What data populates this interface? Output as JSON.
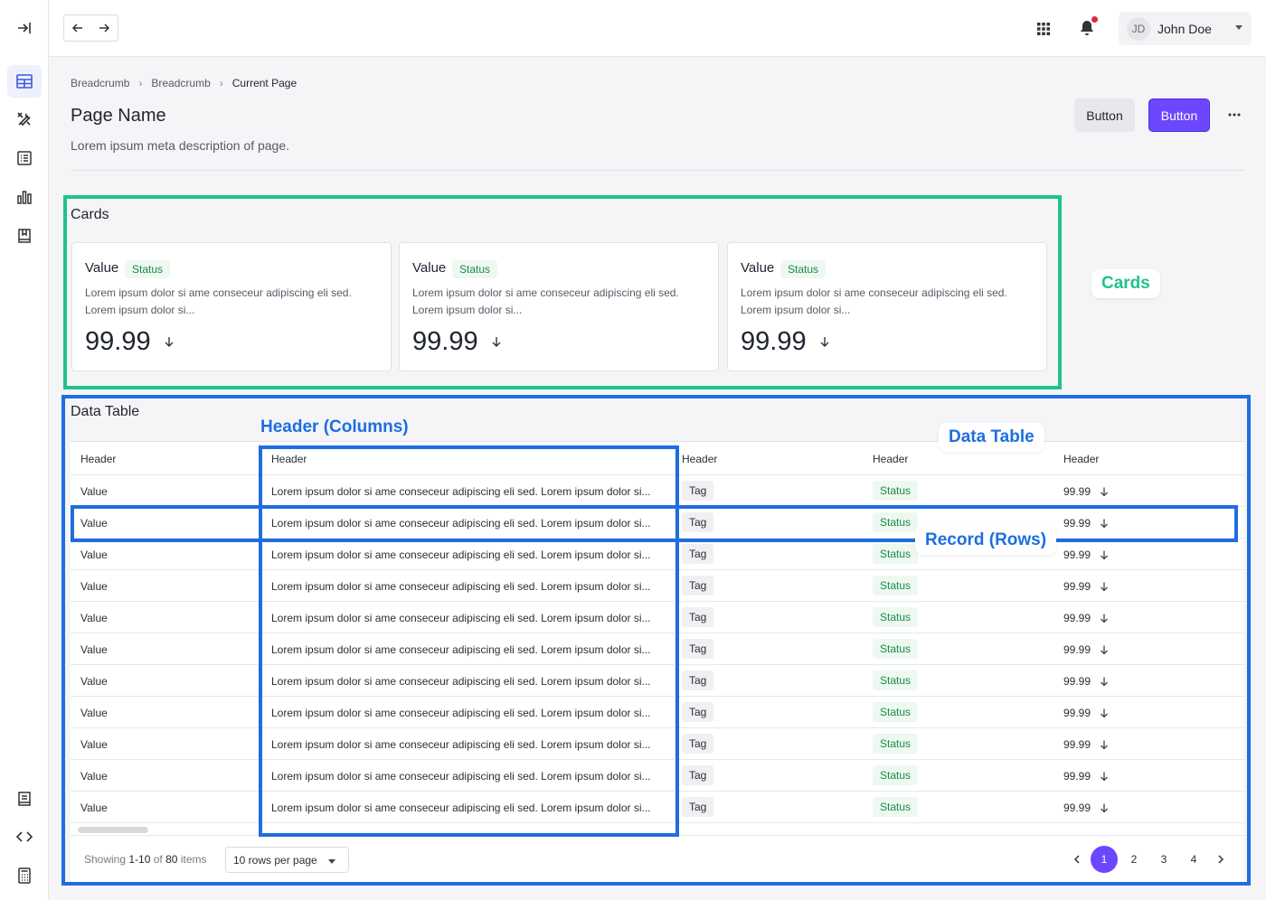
{
  "topbar": {
    "user_initials": "JD",
    "user_name": "John Doe"
  },
  "breadcrumb": [
    "Breadcrumb",
    "Breadcrumb",
    "Current Page"
  ],
  "page": {
    "title": "Page Name",
    "description": "Lorem ipsum meta description of page.",
    "secondary_button": "Button",
    "primary_button": "Button"
  },
  "colors": {
    "primary": "#6c47ff",
    "cards_highlight": "#20c38b",
    "table_highlight": "#1e6ee0",
    "status_text": "#1a8a4a"
  },
  "cards_section": {
    "title": "Cards",
    "cards": [
      {
        "label": "Value",
        "status": "Status",
        "description": "Lorem ipsum dolor si ame conseceur adipiscing eli sed. Lorem ipsum dolor si...",
        "value": "99.99"
      },
      {
        "label": "Value",
        "status": "Status",
        "description": "Lorem ipsum dolor si ame conseceur adipiscing eli sed. Lorem ipsum dolor si...",
        "value": "99.99"
      },
      {
        "label": "Value",
        "status": "Status",
        "description": "Lorem ipsum dolor si ame conseceur adipiscing eli sed. Lorem ipsum dolor si...",
        "value": "99.99"
      }
    ]
  },
  "table_section": {
    "title": "Data Table",
    "headers": [
      "Header",
      "Header",
      "Header",
      "Header",
      "Header"
    ],
    "rows": [
      {
        "value": "Value",
        "text": "Lorem ipsum dolor si ame conseceur adipiscing eli sed. Lorem ipsum dolor si...",
        "tag": "Tag",
        "status": "Status",
        "number": "99.99"
      },
      {
        "value": "Value",
        "text": "Lorem ipsum dolor si ame conseceur adipiscing eli sed. Lorem ipsum dolor si...",
        "tag": "Tag",
        "status": "Status",
        "number": "99.99"
      },
      {
        "value": "Value",
        "text": "Lorem ipsum dolor si ame conseceur adipiscing eli sed. Lorem ipsum dolor si...",
        "tag": "Tag",
        "status": "Status",
        "number": "99.99"
      },
      {
        "value": "Value",
        "text": "Lorem ipsum dolor si ame conseceur adipiscing eli sed. Lorem ipsum dolor si...",
        "tag": "Tag",
        "status": "Status",
        "number": "99.99"
      },
      {
        "value": "Value",
        "text": "Lorem ipsum dolor si ame conseceur adipiscing eli sed. Lorem ipsum dolor si...",
        "tag": "Tag",
        "status": "Status",
        "number": "99.99"
      },
      {
        "value": "Value",
        "text": "Lorem ipsum dolor si ame conseceur adipiscing eli sed. Lorem ipsum dolor si...",
        "tag": "Tag",
        "status": "Status",
        "number": "99.99"
      },
      {
        "value": "Value",
        "text": "Lorem ipsum dolor si ame conseceur adipiscing eli sed. Lorem ipsum dolor si...",
        "tag": "Tag",
        "status": "Status",
        "number": "99.99"
      },
      {
        "value": "Value",
        "text": "Lorem ipsum dolor si ame conseceur adipiscing eli sed. Lorem ipsum dolor si...",
        "tag": "Tag",
        "status": "Status",
        "number": "99.99"
      },
      {
        "value": "Value",
        "text": "Lorem ipsum dolor si ame conseceur adipiscing eli sed. Lorem ipsum dolor si...",
        "tag": "Tag",
        "status": "Status",
        "number": "99.99"
      },
      {
        "value": "Value",
        "text": "Lorem ipsum dolor si ame conseceur adipiscing eli sed. Lorem ipsum dolor si...",
        "tag": "Tag",
        "status": "Status",
        "number": "99.99"
      },
      {
        "value": "Value",
        "text": "Lorem ipsum dolor si ame conseceur adipiscing eli sed. Lorem ipsum dolor si...",
        "tag": "Tag",
        "status": "Status",
        "number": "99.99"
      }
    ],
    "footer": {
      "showing_prefix": "Showing",
      "showing_range": "1-10",
      "showing_of": "of",
      "showing_total": "80",
      "showing_suffix": "items",
      "rows_per_page": "10 rows per page",
      "pages": [
        "1",
        "2",
        "3",
        "4"
      ],
      "current_page": "1"
    }
  },
  "annotations": {
    "cards_label": "Cards",
    "header_columns_label": "Header (Columns)",
    "data_table_label": "Data Table",
    "record_rows_label": "Record (Rows)"
  },
  "icons": [
    "sidebar-expand-icon",
    "table-layout-icon",
    "tools-icon",
    "list-icon",
    "bar-chart-icon",
    "book-icon",
    "document-icon",
    "code-icon",
    "calculator-icon",
    "arrow-left-icon",
    "arrow-right-icon",
    "apps-grid-icon",
    "bell-icon",
    "more-icon",
    "arrow-down-icon",
    "chevron-left-icon",
    "chevron-right-icon"
  ]
}
